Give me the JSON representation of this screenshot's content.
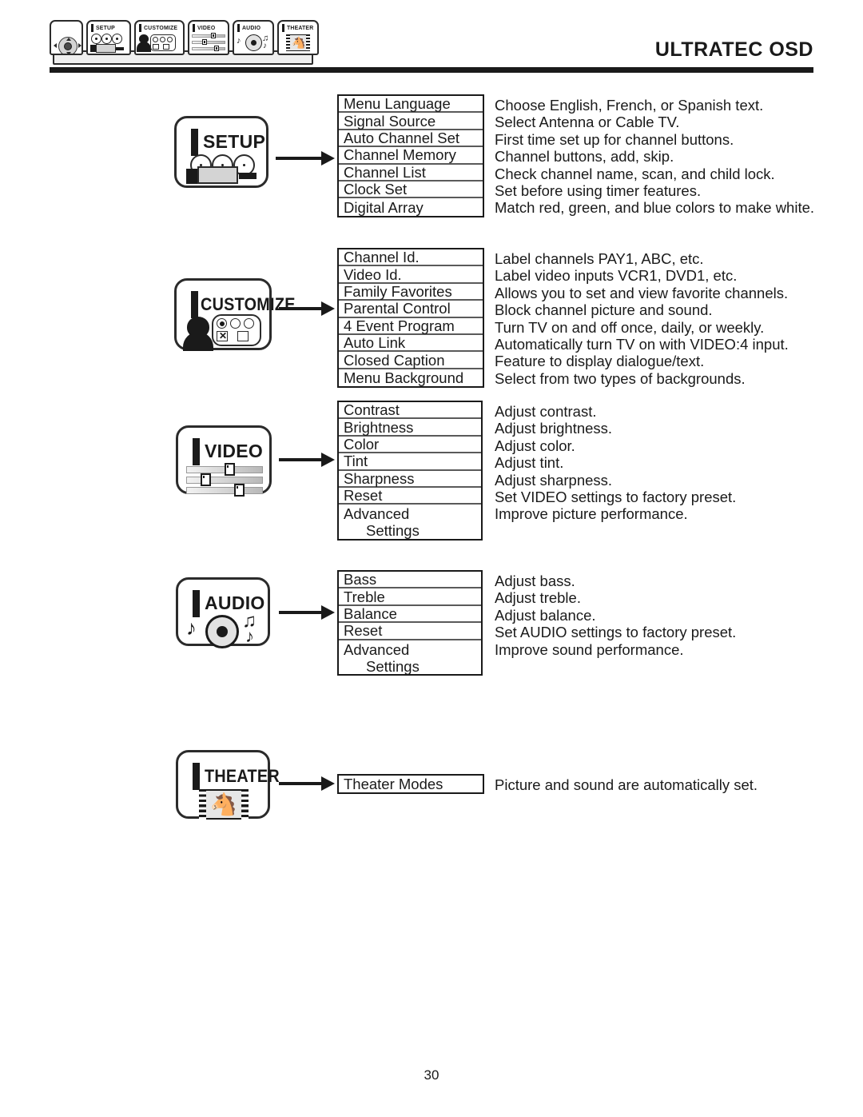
{
  "header": {
    "title": "ULTRATEC OSD",
    "tabs": [
      {
        "label": "",
        "icon": "navigation-pad-icon"
      },
      {
        "label": "SETUP",
        "icon": "setup-jacks-icon"
      },
      {
        "label": "CUSTOMIZE",
        "icon": "customize-person-icon"
      },
      {
        "label": "VIDEO",
        "icon": "video-sliders-icon"
      },
      {
        "label": "AUDIO",
        "icon": "audio-disc-icon"
      },
      {
        "label": "THEATER",
        "icon": "theater-film-icon"
      }
    ]
  },
  "sections": [
    {
      "badge": "SETUP",
      "icon": "setup-jacks-icon",
      "items": [
        {
          "name": "Menu Language",
          "desc": "Choose English, French, or Spanish text."
        },
        {
          "name": "Signal Source",
          "desc": "Select Antenna or Cable TV."
        },
        {
          "name": "Auto Channel Set",
          "desc": "First time set up for channel buttons."
        },
        {
          "name": "Channel Memory",
          "desc": "Channel buttons, add, skip."
        },
        {
          "name": "Channel List",
          "desc": "Check channel name, scan, and child lock."
        },
        {
          "name": "Clock Set",
          "desc": "Set before using timer features."
        },
        {
          "name": "Digital Array",
          "desc": "Match red, green, and blue colors to make white."
        }
      ]
    },
    {
      "badge": "CUSTOMIZE",
      "icon": "customize-person-icon",
      "items": [
        {
          "name": "Channel Id.",
          "desc": "Label channels PAY1, ABC, etc."
        },
        {
          "name": "Video Id.",
          "desc": "Label video inputs VCR1, DVD1, etc."
        },
        {
          "name": "Family Favorites",
          "desc": "Allows you to set and view favorite channels."
        },
        {
          "name": "Parental Control",
          "desc": "Block channel picture and sound."
        },
        {
          "name": "4 Event Program",
          "desc": "Turn TV on and off once, daily, or weekly."
        },
        {
          "name": "Auto Link",
          "desc": "Automatically turn TV on with VIDEO:4 input."
        },
        {
          "name": "Closed Caption",
          "desc": "Feature to display dialogue/text."
        },
        {
          "name": "Menu Background",
          "desc": "Select from two types of backgrounds."
        }
      ]
    },
    {
      "badge": "VIDEO",
      "icon": "video-sliders-icon",
      "items": [
        {
          "name": "Contrast",
          "desc": "Adjust contrast."
        },
        {
          "name": "Brightness",
          "desc": "Adjust brightness."
        },
        {
          "name": "Color",
          "desc": "Adjust color."
        },
        {
          "name": "Tint",
          "desc": "Adjust tint."
        },
        {
          "name": "Sharpness",
          "desc": "Adjust sharpness."
        },
        {
          "name": "Reset",
          "desc": "Set VIDEO settings to factory preset."
        },
        {
          "name": "Advanced",
          "name2": "Settings",
          "desc": "Improve picture performance."
        }
      ]
    },
    {
      "badge": "AUDIO",
      "icon": "audio-disc-icon",
      "items": [
        {
          "name": "Bass",
          "desc": "Adjust bass."
        },
        {
          "name": "Treble",
          "desc": "Adjust treble."
        },
        {
          "name": "Balance",
          "desc": "Adjust balance."
        },
        {
          "name": "Reset",
          "desc": "Set AUDIO settings to factory preset."
        },
        {
          "name": "Advanced",
          "name2": "Settings",
          "desc": "Improve sound performance."
        }
      ]
    },
    {
      "badge": "THEATER",
      "icon": "theater-film-icon",
      "items": [
        {
          "name": "Theater Modes",
          "desc": "Picture and sound are automatically set."
        }
      ]
    }
  ],
  "footer": {
    "page_number": "30"
  },
  "colors": {
    "ink": "#1a1a1a",
    "rule": "#5a5a5a",
    "fill_light": "#e6e6e6",
    "fill_mid": "#d4d4d4"
  }
}
